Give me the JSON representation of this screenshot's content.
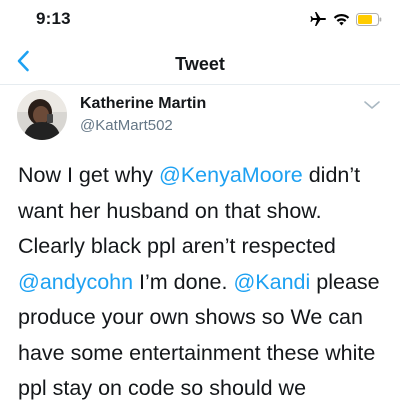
{
  "status_bar": {
    "time": "9:13",
    "icons": [
      "airplane-icon",
      "wifi-icon",
      "battery-icon"
    ],
    "battery_color": "#ffcc00"
  },
  "nav": {
    "title": "Tweet",
    "back_icon": "chevron-left-icon",
    "accent_color": "#1da1f2"
  },
  "tweet": {
    "author": {
      "name": "Katherine Martin",
      "handle": "@KatMart502",
      "avatar_icon": "avatar"
    },
    "more_icon": "chevron-down-icon",
    "segments": [
      {
        "text": "Now I get why ",
        "type": "text"
      },
      {
        "text": "@KenyaMoore",
        "type": "mention"
      },
      {
        "text": " didn’t want her husband on that show. Clearly black ppl aren’t respected ",
        "type": "text"
      },
      {
        "text": "@andycohn",
        "type": "mention"
      },
      {
        "text": " I’m done. ",
        "type": "text"
      },
      {
        "text": "@Kandi",
        "type": "mention"
      },
      {
        "text": " please produce your own shows so We can have some entertainment these white ppl stay on code so should we",
        "type": "text"
      }
    ]
  }
}
